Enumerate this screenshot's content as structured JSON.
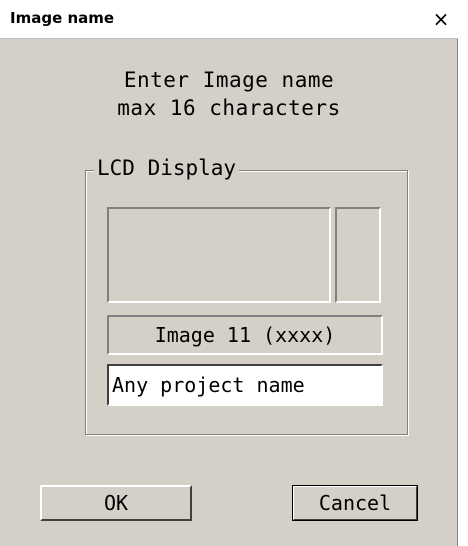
{
  "window": {
    "title": "Image name",
    "close_label": "×"
  },
  "prompt": {
    "line1": "Enter Image name",
    "line2": "max 16 characters"
  },
  "lcd_group": {
    "label": "LCD Display",
    "image_label": "Image 11 (xxxx)"
  },
  "name_input": {
    "value": "Any project name"
  },
  "buttons": {
    "ok": "OK",
    "cancel": "Cancel"
  }
}
